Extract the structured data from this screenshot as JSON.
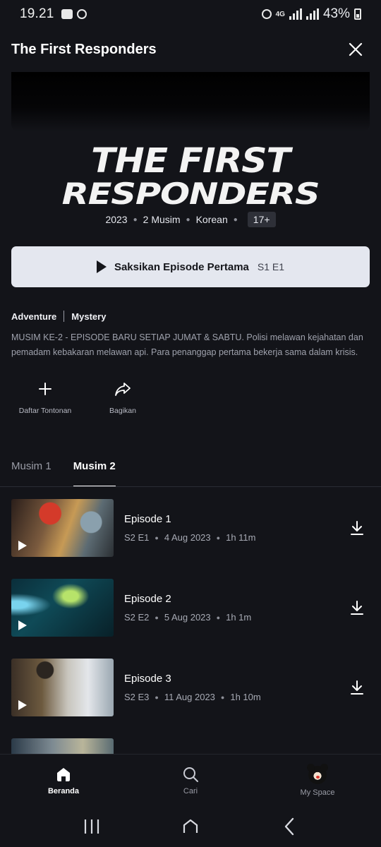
{
  "status_bar": {
    "time": "19.21",
    "network": "4G",
    "battery": "43%"
  },
  "header": {
    "title": "The First Responders"
  },
  "logo": {
    "line1": "THE FIRST",
    "line2": "RESPONDERS"
  },
  "meta": {
    "year": "2023",
    "seasons": "2 Musim",
    "language": "Korean",
    "age_rating": "17+"
  },
  "play_button": {
    "label": "Saksikan Episode Pertama",
    "episode": "S1 E1"
  },
  "genres": [
    "Adventure",
    "Mystery"
  ],
  "description": "MUSIM KE-2 - EPISODE BARU SETIAP JUMAT & SABTU. Polisi melawan kejahatan dan pemadam kebakaran melawan api. Para penanggap pertama bekerja sama dalam krisis.",
  "actions": {
    "watchlist_label": "Daftar Tontonan",
    "share_label": "Bagikan"
  },
  "tabs": [
    {
      "label": "Musim 1",
      "active": false
    },
    {
      "label": "Musim 2",
      "active": true
    }
  ],
  "episodes": [
    {
      "title": "Episode 1",
      "code": "S2 E1",
      "date": "4 Aug 2023",
      "duration": "1h 11m"
    },
    {
      "title": "Episode 2",
      "code": "S2 E2",
      "date": "5 Aug 2023",
      "duration": "1h 1m"
    },
    {
      "title": "Episode 3",
      "code": "S2 E3",
      "date": "11 Aug 2023",
      "duration": "1h 10m"
    }
  ],
  "bottom_nav": [
    {
      "label": "Beranda",
      "icon": "home-icon",
      "active": true
    },
    {
      "label": "Cari",
      "icon": "search-icon",
      "active": false
    },
    {
      "label": "My Space",
      "icon": "avatar",
      "active": false
    }
  ],
  "colors": {
    "background": "#131419",
    "play_button": "#e4e7ef",
    "text_secondary": "#9fa2ad"
  }
}
